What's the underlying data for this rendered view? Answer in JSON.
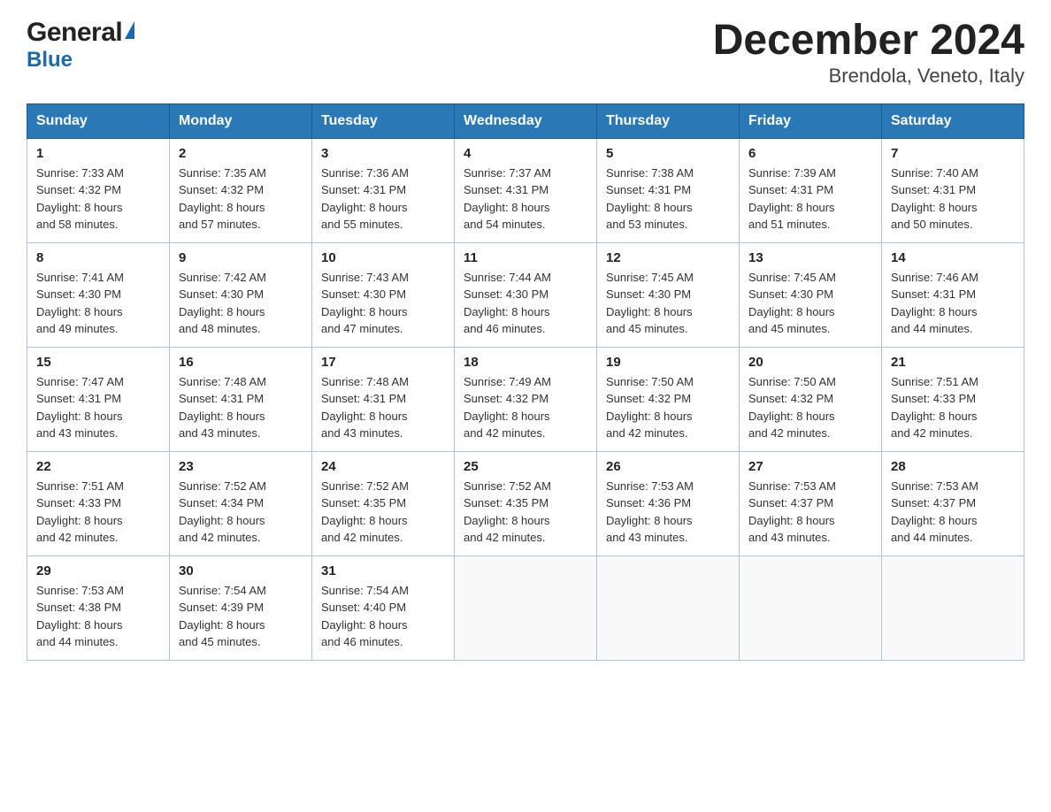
{
  "header": {
    "logo_general": "General",
    "logo_blue": "Blue",
    "title": "December 2024",
    "subtitle": "Brendola, Veneto, Italy"
  },
  "calendar": {
    "days_of_week": [
      "Sunday",
      "Monday",
      "Tuesday",
      "Wednesday",
      "Thursday",
      "Friday",
      "Saturday"
    ],
    "weeks": [
      [
        {
          "day": "1",
          "sunrise": "7:33 AM",
          "sunset": "4:32 PM",
          "daylight": "8 hours and 58 minutes."
        },
        {
          "day": "2",
          "sunrise": "7:35 AM",
          "sunset": "4:32 PM",
          "daylight": "8 hours and 57 minutes."
        },
        {
          "day": "3",
          "sunrise": "7:36 AM",
          "sunset": "4:31 PM",
          "daylight": "8 hours and 55 minutes."
        },
        {
          "day": "4",
          "sunrise": "7:37 AM",
          "sunset": "4:31 PM",
          "daylight": "8 hours and 54 minutes."
        },
        {
          "day": "5",
          "sunrise": "7:38 AM",
          "sunset": "4:31 PM",
          "daylight": "8 hours and 53 minutes."
        },
        {
          "day": "6",
          "sunrise": "7:39 AM",
          "sunset": "4:31 PM",
          "daylight": "8 hours and 51 minutes."
        },
        {
          "day": "7",
          "sunrise": "7:40 AM",
          "sunset": "4:31 PM",
          "daylight": "8 hours and 50 minutes."
        }
      ],
      [
        {
          "day": "8",
          "sunrise": "7:41 AM",
          "sunset": "4:30 PM",
          "daylight": "8 hours and 49 minutes."
        },
        {
          "day": "9",
          "sunrise": "7:42 AM",
          "sunset": "4:30 PM",
          "daylight": "8 hours and 48 minutes."
        },
        {
          "day": "10",
          "sunrise": "7:43 AM",
          "sunset": "4:30 PM",
          "daylight": "8 hours and 47 minutes."
        },
        {
          "day": "11",
          "sunrise": "7:44 AM",
          "sunset": "4:30 PM",
          "daylight": "8 hours and 46 minutes."
        },
        {
          "day": "12",
          "sunrise": "7:45 AM",
          "sunset": "4:30 PM",
          "daylight": "8 hours and 45 minutes."
        },
        {
          "day": "13",
          "sunrise": "7:45 AM",
          "sunset": "4:30 PM",
          "daylight": "8 hours and 45 minutes."
        },
        {
          "day": "14",
          "sunrise": "7:46 AM",
          "sunset": "4:31 PM",
          "daylight": "8 hours and 44 minutes."
        }
      ],
      [
        {
          "day": "15",
          "sunrise": "7:47 AM",
          "sunset": "4:31 PM",
          "daylight": "8 hours and 43 minutes."
        },
        {
          "day": "16",
          "sunrise": "7:48 AM",
          "sunset": "4:31 PM",
          "daylight": "8 hours and 43 minutes."
        },
        {
          "day": "17",
          "sunrise": "7:48 AM",
          "sunset": "4:31 PM",
          "daylight": "8 hours and 43 minutes."
        },
        {
          "day": "18",
          "sunrise": "7:49 AM",
          "sunset": "4:32 PM",
          "daylight": "8 hours and 42 minutes."
        },
        {
          "day": "19",
          "sunrise": "7:50 AM",
          "sunset": "4:32 PM",
          "daylight": "8 hours and 42 minutes."
        },
        {
          "day": "20",
          "sunrise": "7:50 AM",
          "sunset": "4:32 PM",
          "daylight": "8 hours and 42 minutes."
        },
        {
          "day": "21",
          "sunrise": "7:51 AM",
          "sunset": "4:33 PM",
          "daylight": "8 hours and 42 minutes."
        }
      ],
      [
        {
          "day": "22",
          "sunrise": "7:51 AM",
          "sunset": "4:33 PM",
          "daylight": "8 hours and 42 minutes."
        },
        {
          "day": "23",
          "sunrise": "7:52 AM",
          "sunset": "4:34 PM",
          "daylight": "8 hours and 42 minutes."
        },
        {
          "day": "24",
          "sunrise": "7:52 AM",
          "sunset": "4:35 PM",
          "daylight": "8 hours and 42 minutes."
        },
        {
          "day": "25",
          "sunrise": "7:52 AM",
          "sunset": "4:35 PM",
          "daylight": "8 hours and 42 minutes."
        },
        {
          "day": "26",
          "sunrise": "7:53 AM",
          "sunset": "4:36 PM",
          "daylight": "8 hours and 43 minutes."
        },
        {
          "day": "27",
          "sunrise": "7:53 AM",
          "sunset": "4:37 PM",
          "daylight": "8 hours and 43 minutes."
        },
        {
          "day": "28",
          "sunrise": "7:53 AM",
          "sunset": "4:37 PM",
          "daylight": "8 hours and 44 minutes."
        }
      ],
      [
        {
          "day": "29",
          "sunrise": "7:53 AM",
          "sunset": "4:38 PM",
          "daylight": "8 hours and 44 minutes."
        },
        {
          "day": "30",
          "sunrise": "7:54 AM",
          "sunset": "4:39 PM",
          "daylight": "8 hours and 45 minutes."
        },
        {
          "day": "31",
          "sunrise": "7:54 AM",
          "sunset": "4:40 PM",
          "daylight": "8 hours and 46 minutes."
        },
        null,
        null,
        null,
        null
      ]
    ],
    "labels": {
      "sunrise": "Sunrise:",
      "sunset": "Sunset:",
      "daylight": "Daylight:"
    }
  }
}
